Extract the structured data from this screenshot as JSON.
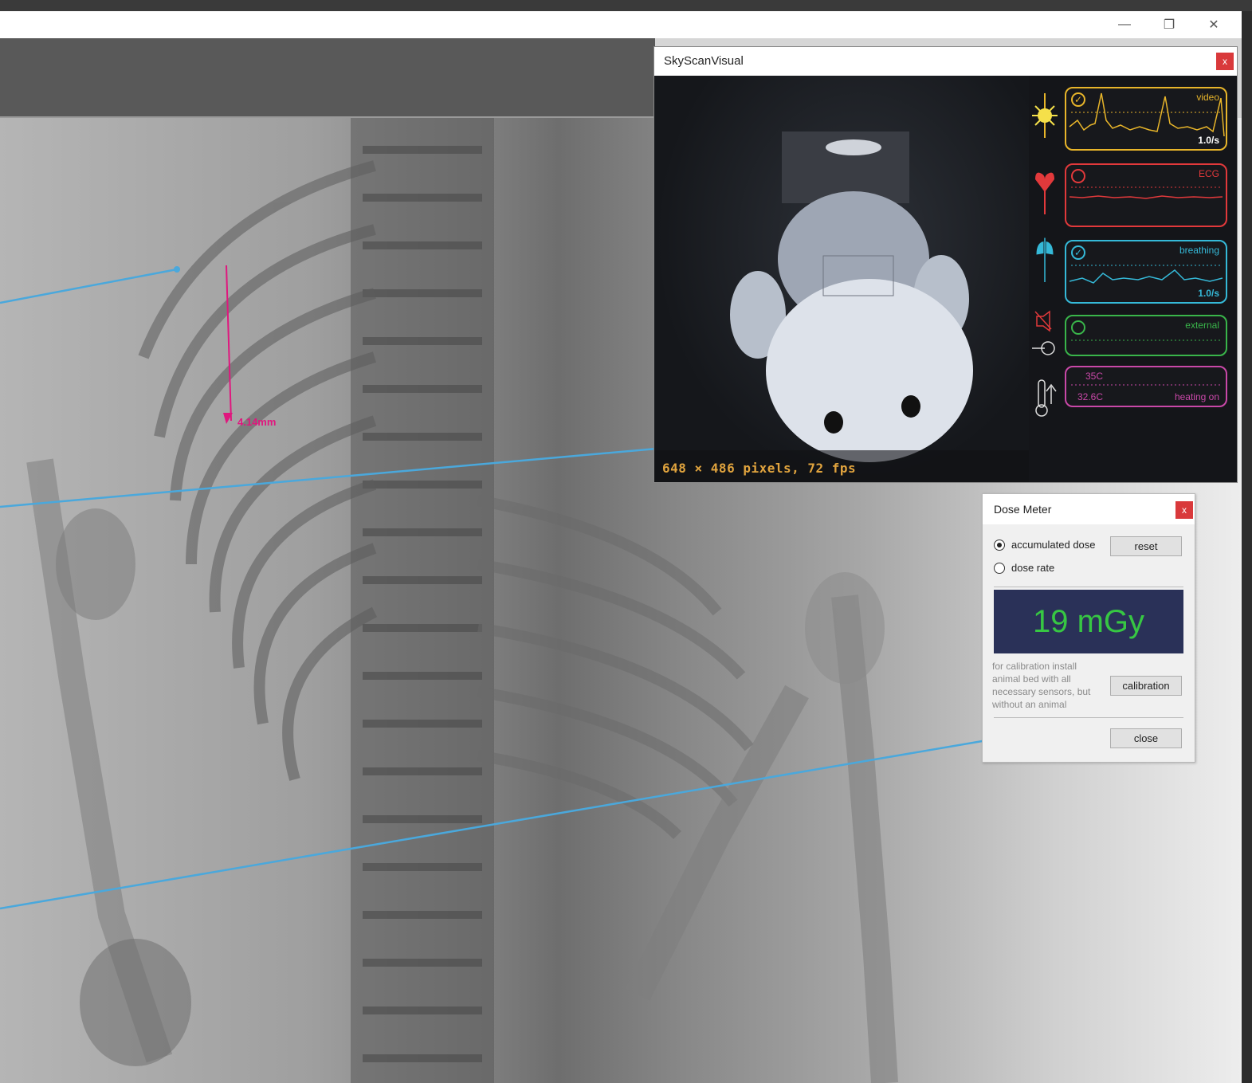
{
  "window": {
    "minimize_icon": "—",
    "restore_icon": "❐",
    "close_icon": "✕"
  },
  "xray": {
    "measurement_label": "4.14mm",
    "colors": {
      "callout": "#4aa8dc",
      "measurement": "#e0177e"
    }
  },
  "skyscan": {
    "title": "SkyScanVisual",
    "close": "x",
    "camera_info": "648 × 486 pixels, 72 fps",
    "panels": [
      {
        "id": "video",
        "label": "video",
        "rate": "1.0/s",
        "checked": true,
        "color": "#e8b52a",
        "icon": "sun-icon"
      },
      {
        "id": "ecg",
        "label": "ECG",
        "rate": "",
        "checked": false,
        "color": "#e2393b",
        "icon": "heart-icon"
      },
      {
        "id": "breathing",
        "label": "breathing",
        "rate": "1.0/s",
        "checked": true,
        "color": "#35b9d8",
        "icon": "lungs-icon"
      },
      {
        "id": "external",
        "label": "external",
        "rate": "",
        "checked": false,
        "color": "#39b54a",
        "icon": "trigger-icon"
      }
    ],
    "temperature": {
      "setpoint": "35C",
      "current": "32.6C",
      "status": "heating on",
      "color": "#c948a8",
      "icon": "thermometer-icon"
    }
  },
  "dose_meter": {
    "title": "Dose Meter",
    "close": "x",
    "option_accumulated": "accumulated dose",
    "option_rate": "dose rate",
    "selected": "accumulated dose",
    "reset_label": "reset",
    "value": "19 mGy",
    "calibration_note": "for calibration install animal bed with all necessary sensors, but without an animal",
    "calibration_label": "calibration",
    "close_label": "close",
    "colors": {
      "display_bg": "#2a3158",
      "display_text": "#37c743"
    }
  }
}
